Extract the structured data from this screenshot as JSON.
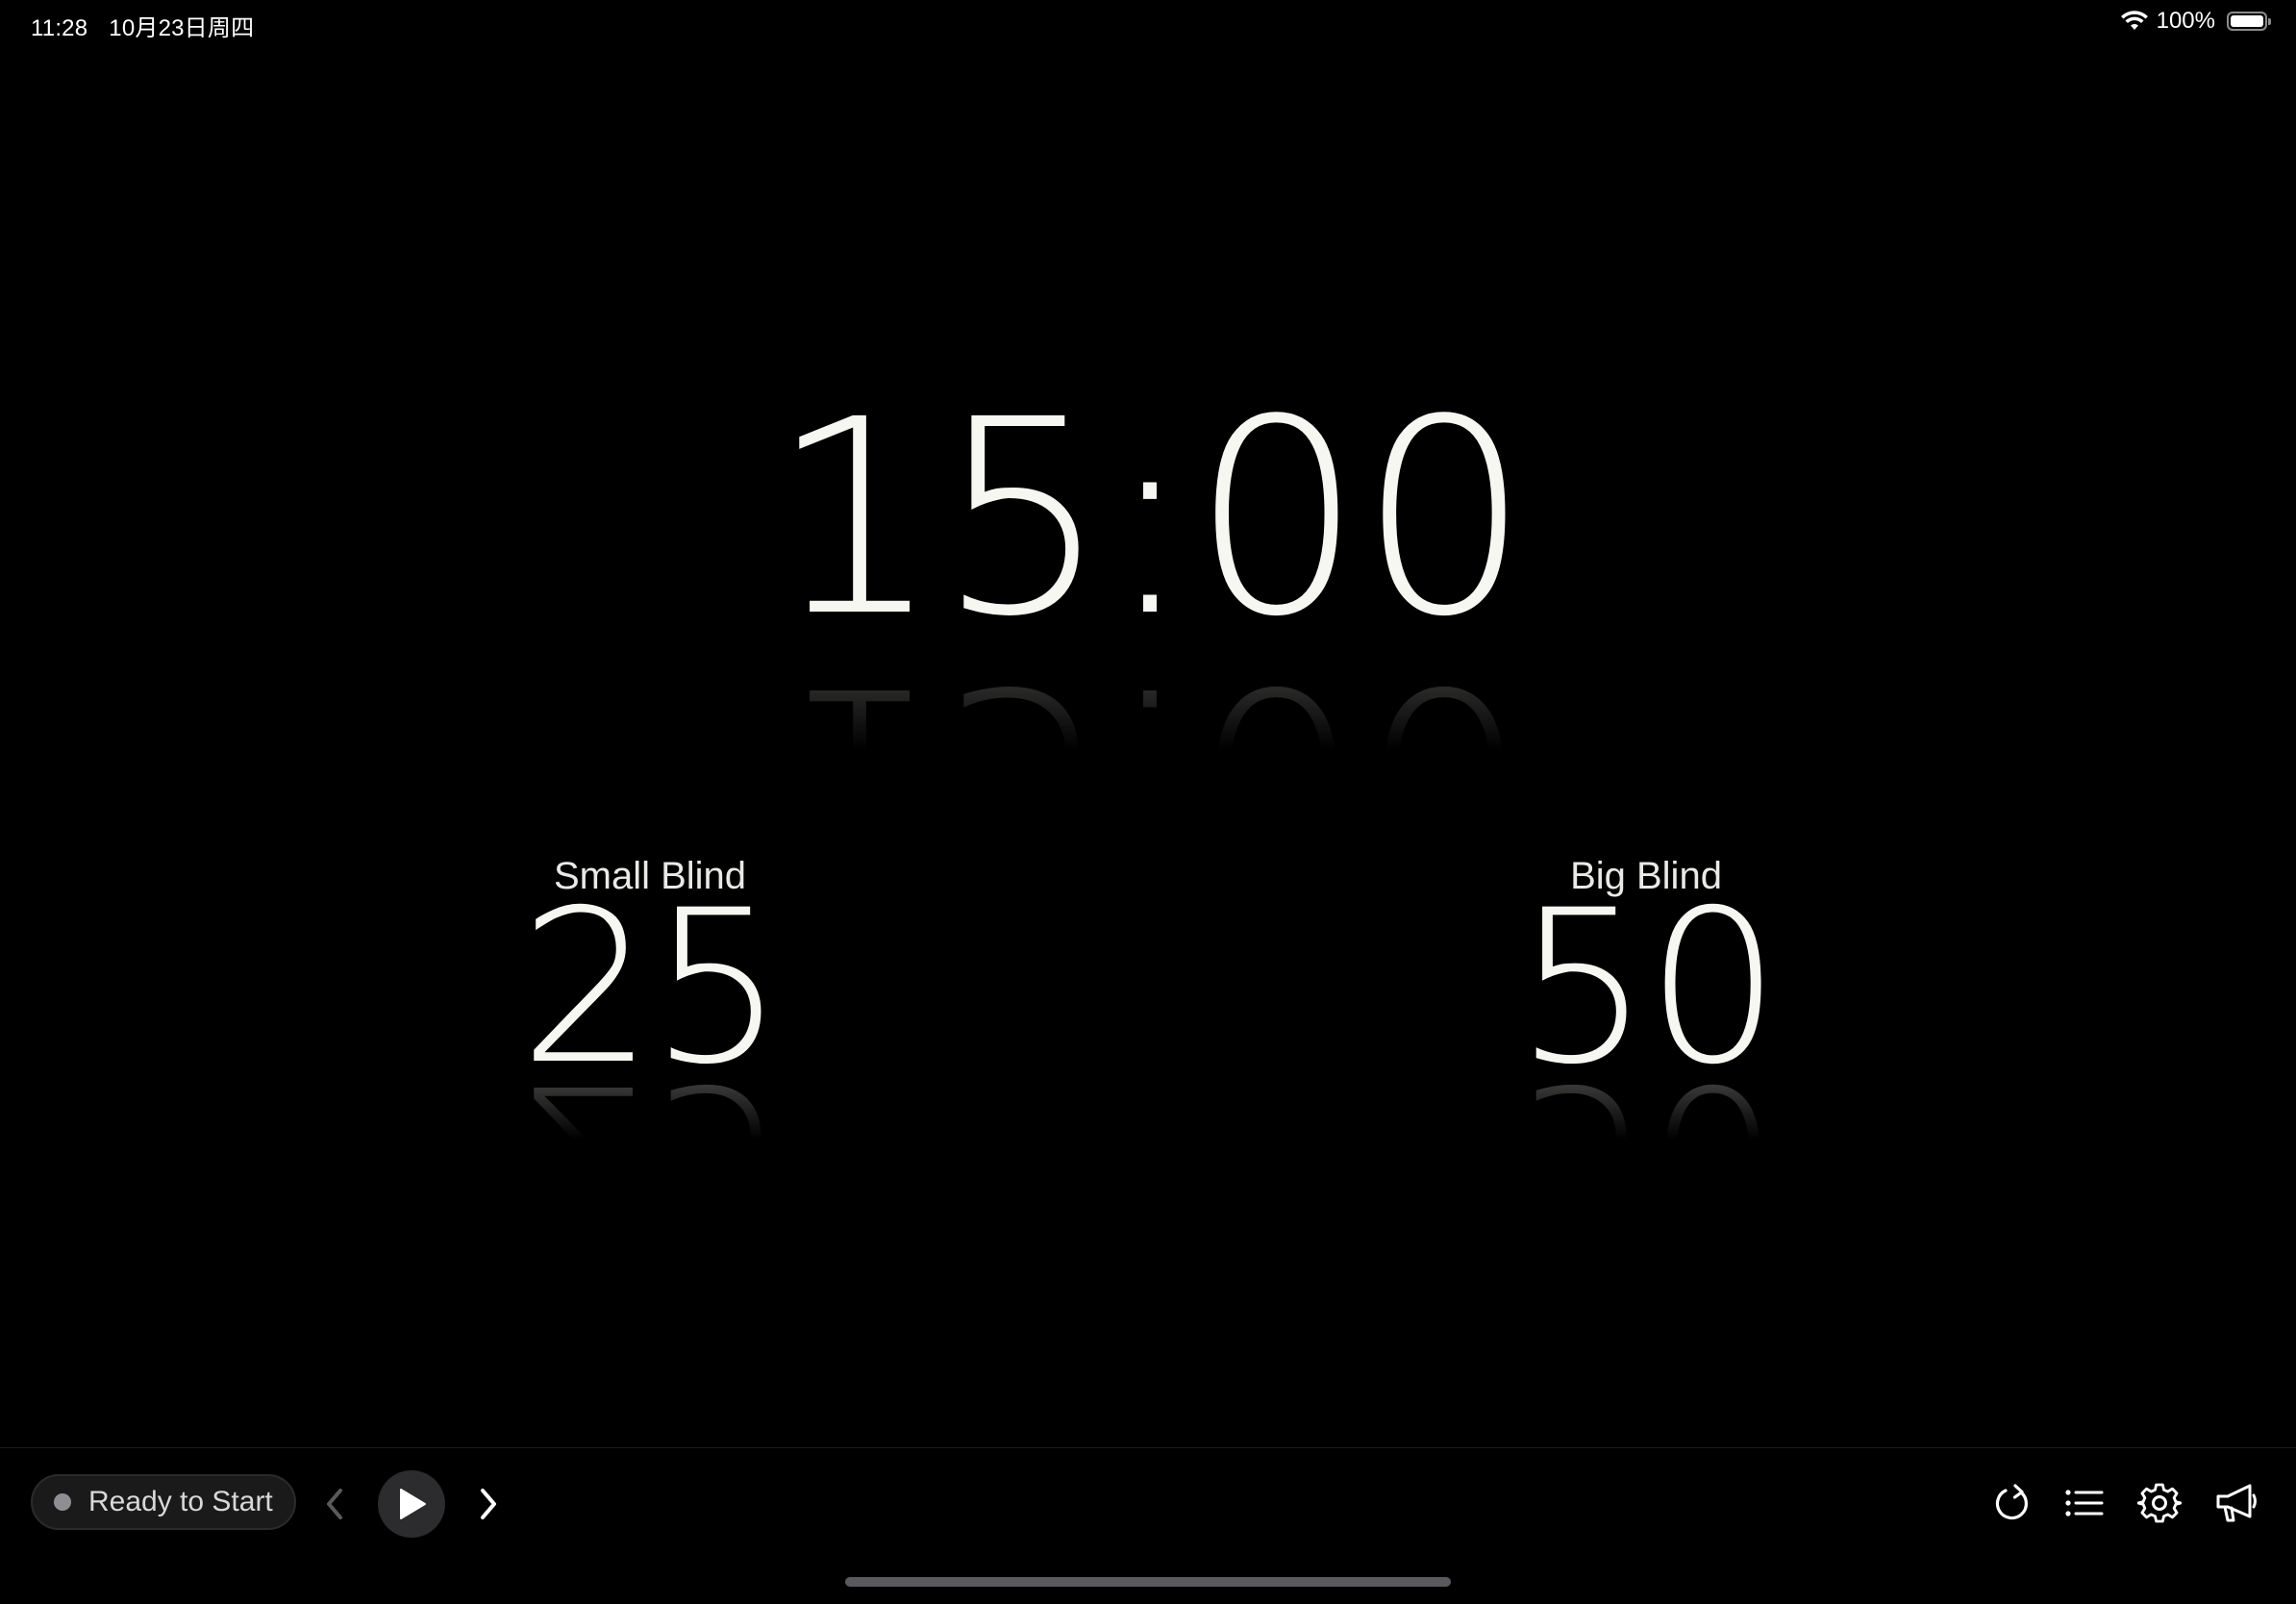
{
  "status_bar": {
    "time": "11:28",
    "date": "10月23日周四",
    "battery_text": "100%",
    "battery_level": 1.0
  },
  "timer": {
    "display": "15:00"
  },
  "blinds": {
    "small_label": "Small Blind",
    "small_value": "25",
    "big_label": "Big Blind",
    "big_value": "50"
  },
  "toolbar": {
    "status_text": "Ready to Start",
    "status_color": "#8e8e93",
    "icons": {
      "prev": "chevron-left-icon",
      "play": "play-icon",
      "next": "chevron-right-icon",
      "reset": "reset-icon",
      "list": "list-icon",
      "settings": "gear-icon",
      "announce": "megaphone-icon"
    }
  }
}
